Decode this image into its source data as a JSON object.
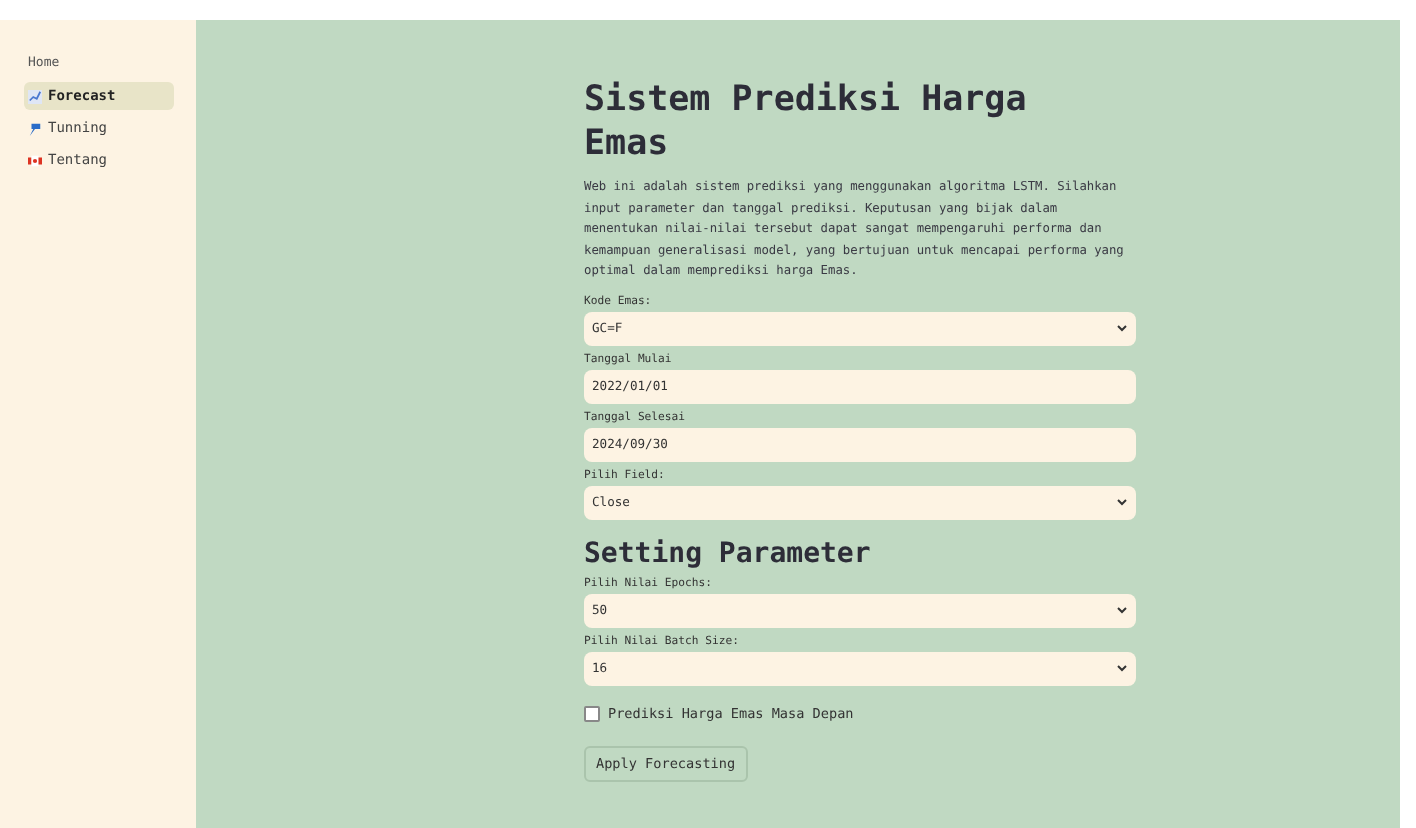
{
  "sidebar": {
    "heading": "Home",
    "items": [
      {
        "label": "Forecast",
        "kind": "chart",
        "selected": true
      },
      {
        "label": "Tunning",
        "kind": "pin",
        "selected": false
      },
      {
        "label": "Tentang",
        "kind": "flag",
        "selected": false
      }
    ]
  },
  "main": {
    "title": "Sistem Prediksi Harga Emas",
    "description": "Web ini adalah sistem prediksi yang menggunakan algoritma LSTM. Silahkan input parameter dan tanggal prediksi. Keputusan yang bijak dalam menentukan nilai-nilai tersebut dapat sangat mempengaruhi performa dan kemampuan generalisasi model, yang bertujuan untuk mencapai performa yang optimal dalam memprediksi harga Emas.",
    "fields": [
      {
        "kind": "select",
        "label": "Kode Emas:",
        "value": "GC=F"
      },
      {
        "kind": "date",
        "label": "Tanggal Mulai",
        "value": "2022/01/01"
      },
      {
        "kind": "date",
        "label": "Tanggal Selesai",
        "value": "2024/09/30"
      },
      {
        "kind": "select",
        "label": "Pilih Field:",
        "value": "Close"
      }
    ],
    "section_title": "Setting Parameter",
    "parameters": [
      {
        "kind": "select",
        "label": "Pilih Nilai Epochs:",
        "value": "50"
      },
      {
        "kind": "select",
        "label": "Pilih Nilai Batch Size:",
        "value": "16"
      }
    ],
    "checkbox": {
      "label": "Prediksi Harga Emas Masa Depan",
      "checked": false
    },
    "button": "Apply Forecasting"
  }
}
